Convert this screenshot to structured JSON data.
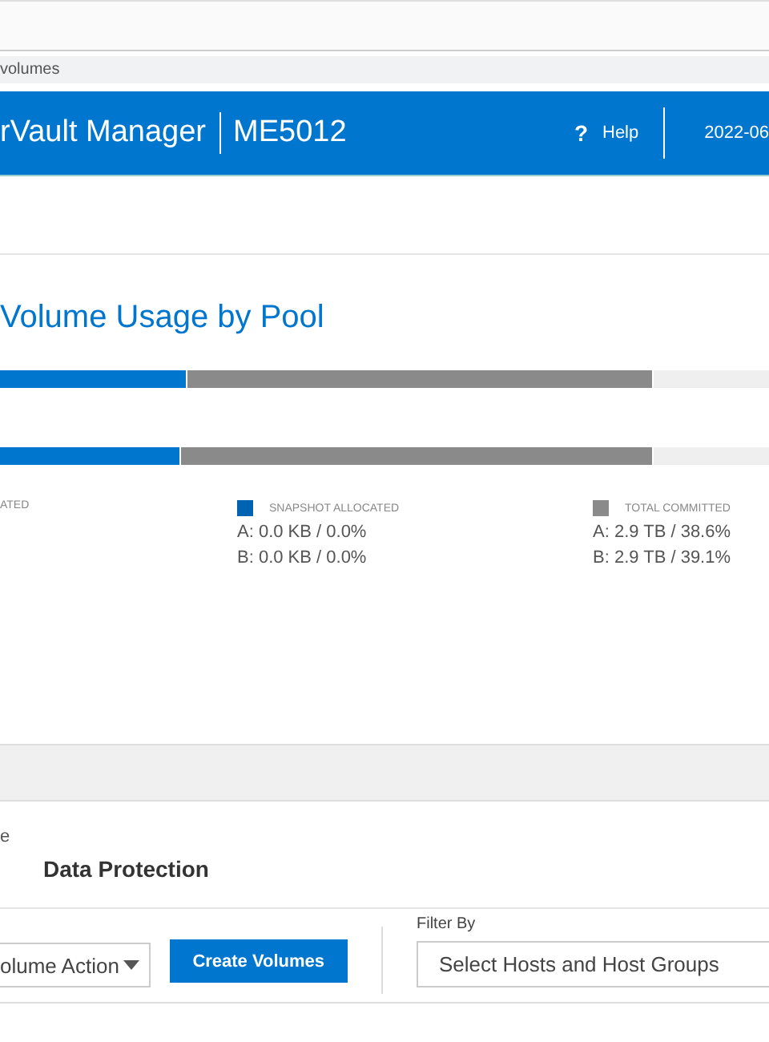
{
  "address_bar": {
    "path": "volumes"
  },
  "header": {
    "title": "rVault Manager",
    "system": "ME5012",
    "help_icon": "?",
    "help": "Help",
    "date": "2022-06"
  },
  "usage_card": {
    "title": "Volume Usage by Pool",
    "bars": [
      {
        "segments": [
          {
            "kind": "allocated",
            "level": 0.244
          },
          {
            "kind": "committed",
            "level": 0.85
          }
        ]
      },
      {
        "segments": [
          {
            "kind": "allocated",
            "level": 0.235
          },
          {
            "kind": "committed",
            "level": 0.85
          }
        ]
      }
    ],
    "legend": [
      {
        "label": "ATED",
        "kind": "none"
      },
      {
        "label": "SNAPSHOT ALLOCATED",
        "kind": "snapshot",
        "lines": [
          "A: 0.0 KB / 0.0%",
          "B: 0.0 KB / 0.0%"
        ]
      },
      {
        "label": "TOTAL COMMITTED",
        "kind": "committed",
        "lines": [
          "A: 2.9 TB / 38.6%",
          "B: 2.9 TB / 39.1%"
        ]
      }
    ]
  },
  "volumes_card": {
    "heading_fragment": "e",
    "tab": "Data Protection",
    "action_select": "olume Action",
    "create_button": "Create Volumes",
    "filter_label": "Filter By",
    "filter_placeholder": "Select Hosts and Host Groups"
  }
}
